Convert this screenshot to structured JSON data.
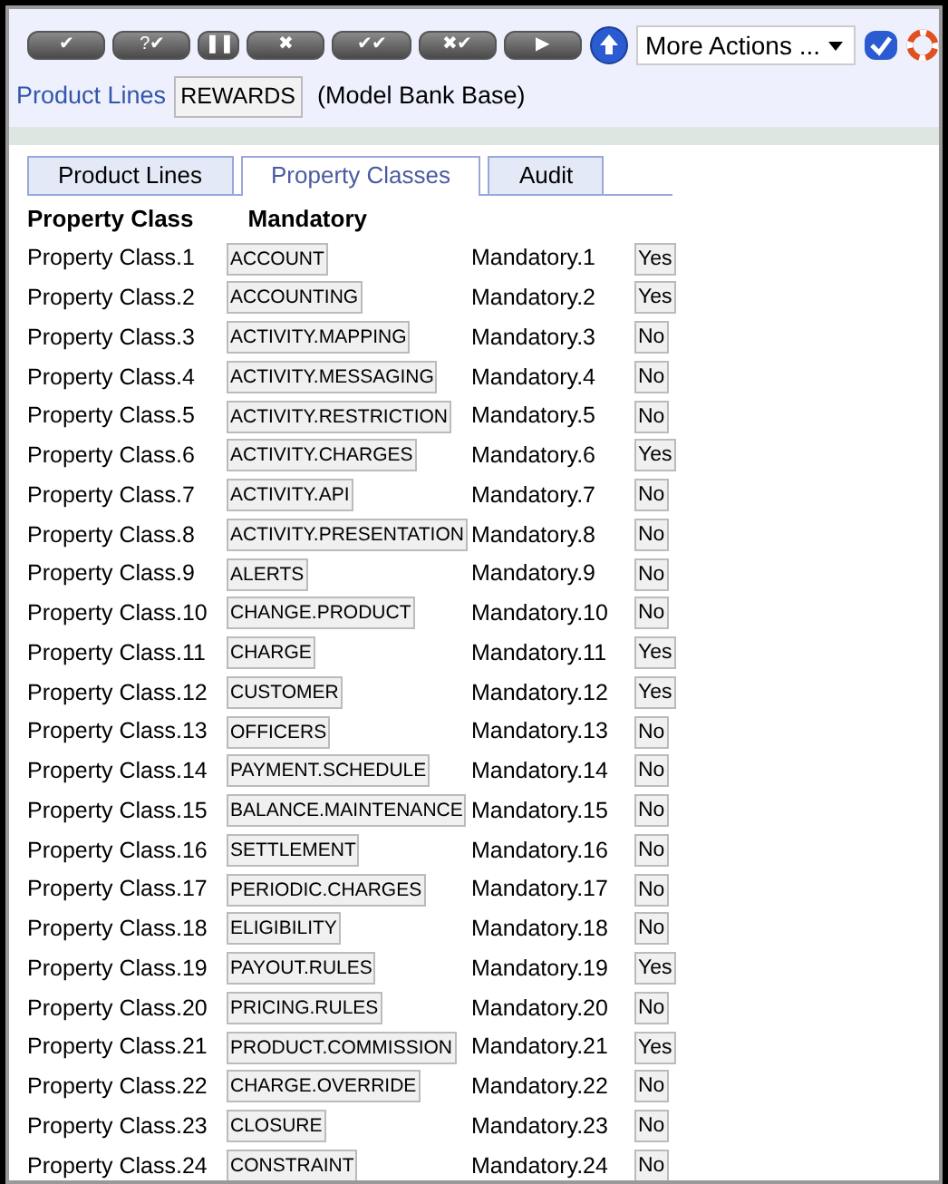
{
  "toolbar": {
    "buttons": [
      {
        "label": "✔"
      },
      {
        "label": "?✔"
      },
      {
        "label": "❚❚",
        "kind": "narrow"
      },
      {
        "label": "✖"
      },
      {
        "label": "✔✔"
      },
      {
        "label": "✖✔"
      },
      {
        "label": "▶"
      }
    ],
    "actions": {
      "value": "More Actions ..."
    }
  },
  "header": {
    "title": "Product Lines",
    "id": "REWARDS",
    "note": "(Model Bank Base)"
  },
  "tabs": [
    {
      "label": "Product Lines",
      "selected": false
    },
    {
      "label": "Property Classes",
      "selected": true
    },
    {
      "label": "Audit",
      "selected": false
    }
  ],
  "columns": [
    "Property Class",
    "Mandatory"
  ],
  "rows": [
    {
      "label": "Property Class.1",
      "value": "ACCOUNT",
      "mandatory_label": "Mandatory.1",
      "mandatory": "Yes"
    },
    {
      "label": "Property Class.2",
      "value": "ACCOUNTING",
      "mandatory_label": "Mandatory.2",
      "mandatory": "Yes"
    },
    {
      "label": "Property Class.3",
      "value": "ACTIVITY.MAPPING",
      "mandatory_label": "Mandatory.3",
      "mandatory": "No"
    },
    {
      "label": "Property Class.4",
      "value": "ACTIVITY.MESSAGING",
      "mandatory_label": "Mandatory.4",
      "mandatory": "No"
    },
    {
      "label": "Property Class.5",
      "value": "ACTIVITY.RESTRICTION",
      "mandatory_label": "Mandatory.5",
      "mandatory": "No"
    },
    {
      "label": "Property Class.6",
      "value": "ACTIVITY.CHARGES",
      "mandatory_label": "Mandatory.6",
      "mandatory": "Yes"
    },
    {
      "label": "Property Class.7",
      "value": "ACTIVITY.API",
      "mandatory_label": "Mandatory.7",
      "mandatory": "No"
    },
    {
      "label": "Property Class.8",
      "value": "ACTIVITY.PRESENTATION",
      "mandatory_label": "Mandatory.8",
      "mandatory": "No"
    },
    {
      "label": "Property Class.9",
      "value": "ALERTS",
      "mandatory_label": "Mandatory.9",
      "mandatory": "No"
    },
    {
      "label": "Property Class.10",
      "value": "CHANGE.PRODUCT",
      "mandatory_label": "Mandatory.10",
      "mandatory": "No"
    },
    {
      "label": "Property Class.11",
      "value": "CHARGE",
      "mandatory_label": "Mandatory.11",
      "mandatory": "Yes"
    },
    {
      "label": "Property Class.12",
      "value": "CUSTOMER",
      "mandatory_label": "Mandatory.12",
      "mandatory": "Yes"
    },
    {
      "label": "Property Class.13",
      "value": "OFFICERS",
      "mandatory_label": "Mandatory.13",
      "mandatory": "No"
    },
    {
      "label": "Property Class.14",
      "value": "PAYMENT.SCHEDULE",
      "mandatory_label": "Mandatory.14",
      "mandatory": "No"
    },
    {
      "label": "Property Class.15",
      "value": "BALANCE.MAINTENANCE",
      "mandatory_label": "Mandatory.15",
      "mandatory": "No"
    },
    {
      "label": "Property Class.16",
      "value": "SETTLEMENT",
      "mandatory_label": "Mandatory.16",
      "mandatory": "No"
    },
    {
      "label": "Property Class.17",
      "value": "PERIODIC.CHARGES",
      "mandatory_label": "Mandatory.17",
      "mandatory": "No"
    },
    {
      "label": "Property Class.18",
      "value": "ELIGIBILITY",
      "mandatory_label": "Mandatory.18",
      "mandatory": "No"
    },
    {
      "label": "Property Class.19",
      "value": "PAYOUT.RULES",
      "mandatory_label": "Mandatory.19",
      "mandatory": "Yes"
    },
    {
      "label": "Property Class.20",
      "value": "PRICING.RULES",
      "mandatory_label": "Mandatory.20",
      "mandatory": "No"
    },
    {
      "label": "Property Class.21",
      "value": "PRODUCT.COMMISSION",
      "mandatory_label": "Mandatory.21",
      "mandatory": "Yes"
    },
    {
      "label": "Property Class.22",
      "value": "CHARGE.OVERRIDE",
      "mandatory_label": "Mandatory.22",
      "mandatory": "No"
    },
    {
      "label": "Property Class.23",
      "value": "CLOSURE",
      "mandatory_label": "Mandatory.23",
      "mandatory": "No"
    },
    {
      "label": "Property Class.24",
      "value": "CONSTRAINT",
      "mandatory_label": "Mandatory.24",
      "mandatory": "No"
    }
  ]
}
